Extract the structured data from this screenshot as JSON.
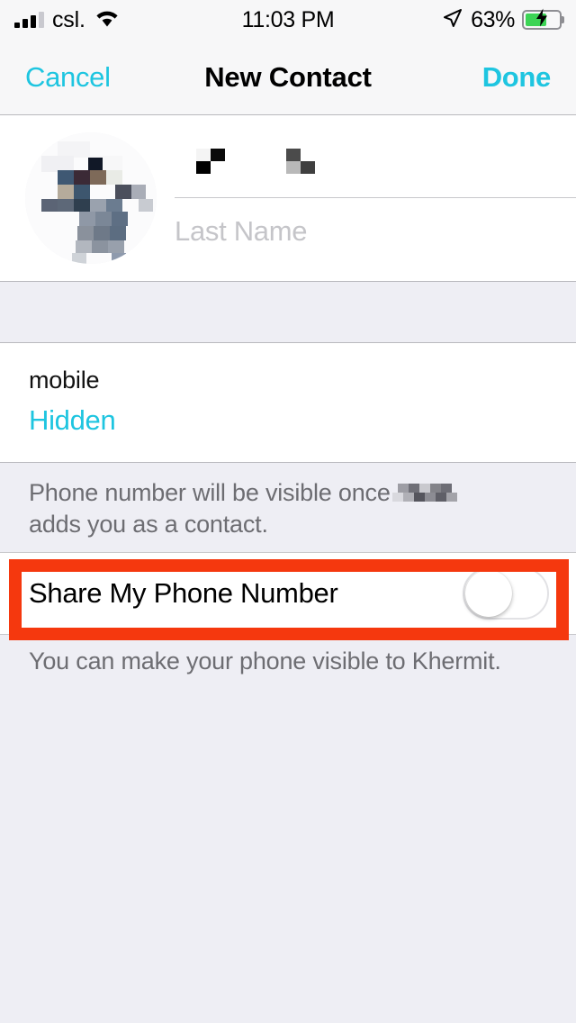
{
  "status_bar": {
    "carrier": "csl.",
    "time": "11:03 PM",
    "battery_percent": "63%",
    "battery_level": 63,
    "charging": true,
    "signal_bars_filled": 3,
    "signal_bars_total": 4,
    "wifi_icon": "wifi-icon",
    "location_icon": "location-arrow-icon",
    "battery_icon": "battery-charging-icon"
  },
  "nav_bar": {
    "cancel_label": "Cancel",
    "title": "New Contact",
    "done_label": "Done"
  },
  "name_section": {
    "avatar_alt": "contact-photo",
    "first_name_value": "",
    "first_name_redacted": true,
    "last_name_placeholder": "Last Name",
    "last_name_value": ""
  },
  "phone_section": {
    "label": "mobile",
    "value": "Hidden",
    "footer_before": "Phone number will be visible once",
    "footer_after": "adds you as a contact.",
    "footer_name_redacted": true
  },
  "share_section": {
    "toggle_label": "Share My Phone Number",
    "toggle_on": false,
    "footer": "You can make your phone visible to Khermit."
  },
  "annotation": {
    "type": "highlight-box",
    "color": "#f5380e",
    "target": "share-my-phone-number-row"
  },
  "colors": {
    "accent": "#1ec5e0",
    "background": "#eeeef4",
    "card": "#ffffff",
    "text_primary": "#000000",
    "text_secondary": "#6d6d72",
    "placeholder": "#c5c5c9",
    "battery_green": "#3cd455",
    "annotation_red": "#f5380e"
  }
}
